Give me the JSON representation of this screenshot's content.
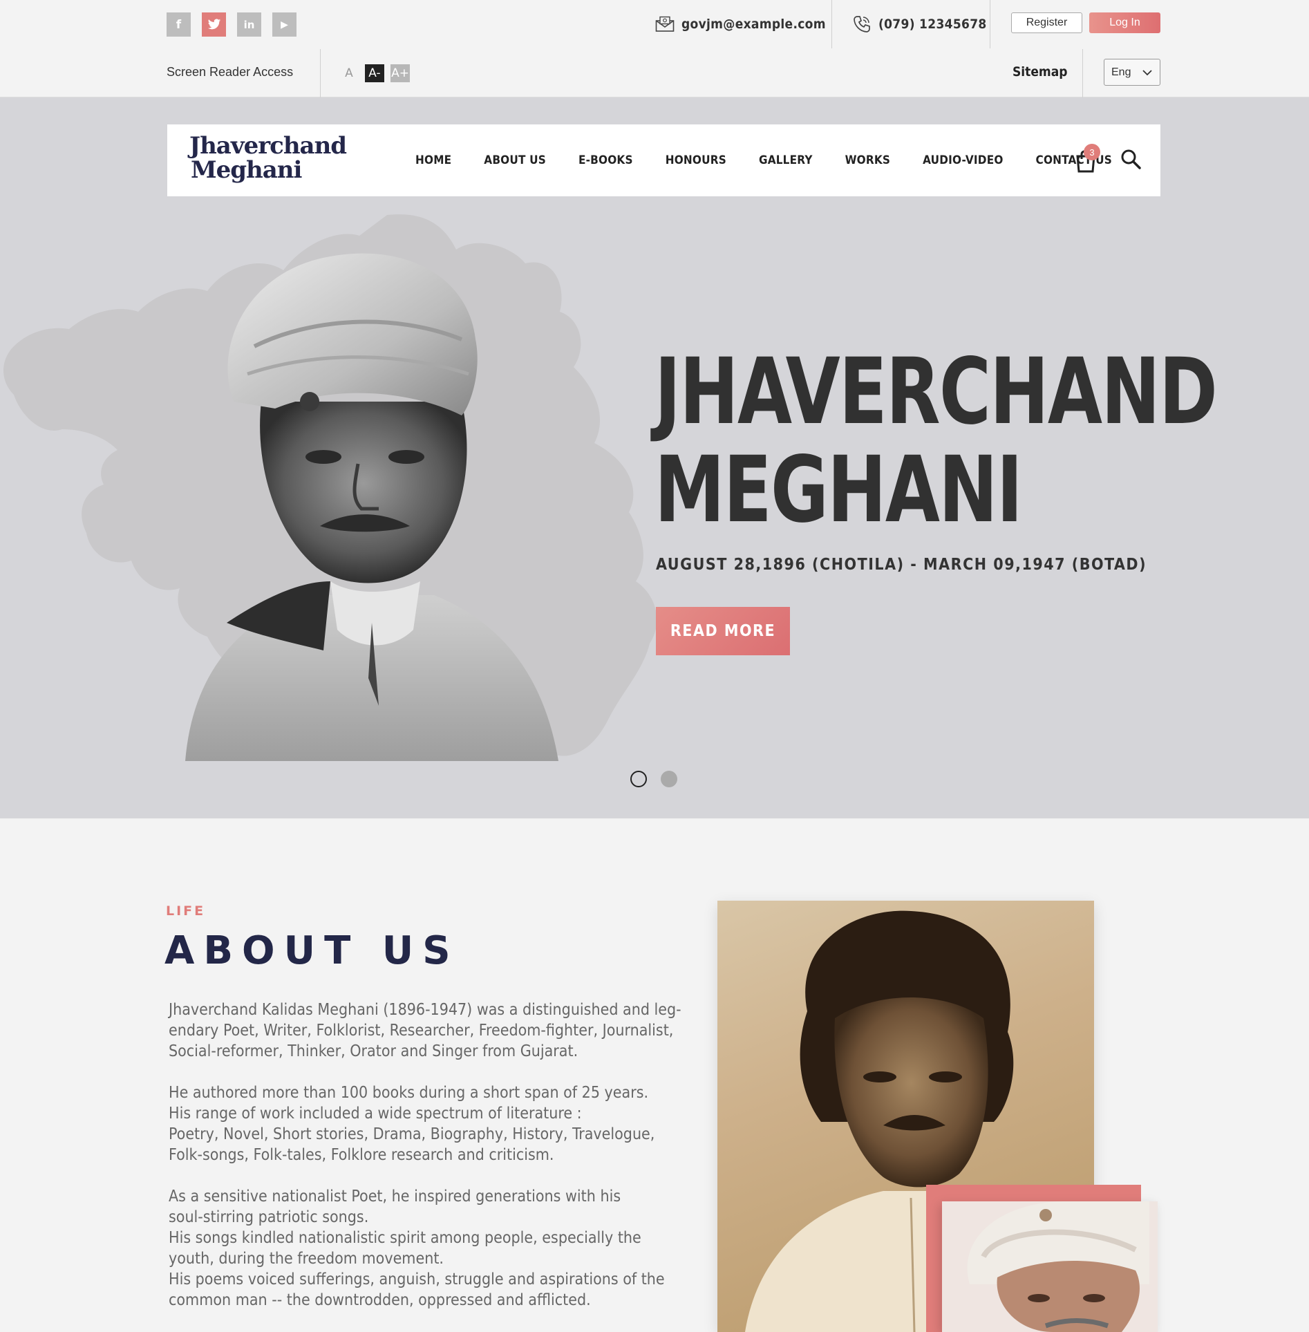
{
  "topbar": {
    "social": [
      {
        "name": "facebook-icon",
        "glyph": "f"
      },
      {
        "name": "twitter-icon",
        "glyph": "t"
      },
      {
        "name": "linkedin-icon",
        "glyph": "in"
      },
      {
        "name": "youtube-icon",
        "glyph": "▶"
      }
    ],
    "email": "govjm@example.com",
    "phone": "(079) 12345678",
    "register_label": "Register",
    "login_label": "Log In",
    "screen_reader_label": "Screen Reader Access",
    "font_small": "A",
    "font_minus": "A-",
    "font_plus": "A+",
    "sitemap_label": "Sitemap",
    "language": "Eng"
  },
  "nav": {
    "logo_line1": "Jhaverchand",
    "logo_line2": "Meghani",
    "items": [
      "HOME",
      "ABOUT US",
      "E-BOOKS",
      "HONOURS",
      "GALLERY",
      "WORKS",
      "AUDIO-VIDEO",
      "CONTACT US"
    ],
    "cart_count": "3"
  },
  "hero": {
    "title_line1": "JHAVERCHAND",
    "title_line2": "MEGHANI",
    "dates": "AUGUST 28,1896 (CHOTILA) - MARCH 09,1947 (BOTAD)",
    "cta_label": "READ MORE",
    "slides": 2,
    "active_slide": 1
  },
  "about": {
    "kicker": "LIFE",
    "title": "ABOUT US",
    "p1": [
      "Jhaverchand Kalidas Meghani (1896-1947) was a distinguished and leg-",
      "endary Poet, Writer, Folklorist, Researcher, Freedom-fighter, Journalist,",
      "Social-reformer, Thinker, Orator and Singer from Gujarat."
    ],
    "p2": [
      "He authored more than 100 books during a short span of 25 years.",
      "His range of work included a wide spectrum of literature :",
      "Poetry, Novel, Short stories, Drama, Biography, History, Travelogue,",
      "Folk-songs, Folk-tales, Folklore research and criticism."
    ],
    "p3": [
      "As a sensitive nationalist Poet, he inspired generations with his",
      "soul-stirring patriotic songs.",
      "His songs kindled nationalistic spirit among people, especially the",
      "youth, during the freedom movement.",
      "His poems voiced sufferings, anguish, struggle and aspirations of the",
      "common man -- the downtrodden, oppressed and afflicted."
    ]
  },
  "colors": {
    "accent": "#e07d7a",
    "navy": "#232748",
    "hero_bg": "#d5d5d9",
    "page_bg": "#f3f3f3"
  }
}
